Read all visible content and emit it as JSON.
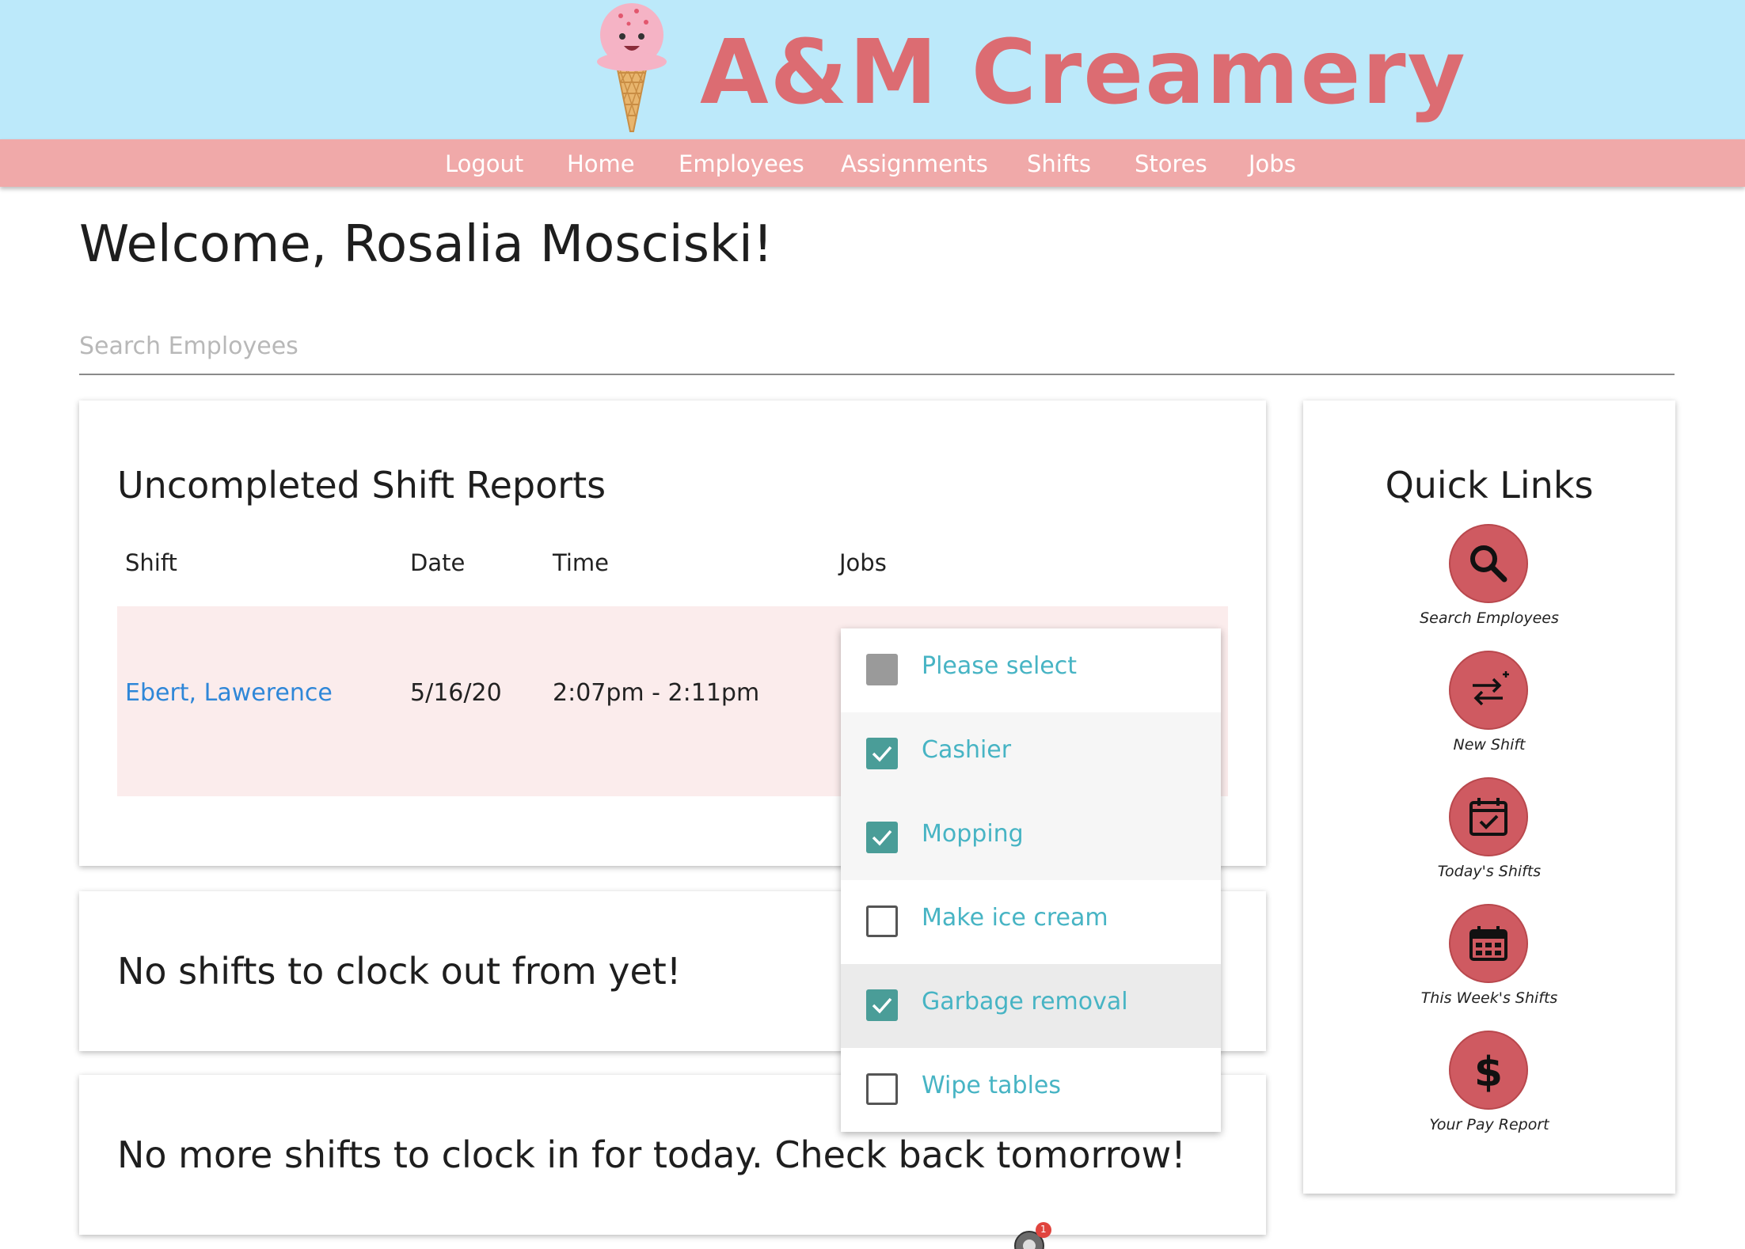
{
  "header": {
    "brand": "A&M Creamery",
    "logo": "ice-cream-cone-icon"
  },
  "nav": {
    "items": [
      {
        "label": "Logout"
      },
      {
        "label": "Home"
      },
      {
        "label": "Employees"
      },
      {
        "label": "Assignments"
      },
      {
        "label": "Shifts"
      },
      {
        "label": "Stores"
      },
      {
        "label": "Jobs"
      }
    ]
  },
  "welcome": "Welcome, Rosalia Mosciski!",
  "search": {
    "placeholder": "Search Employees",
    "value": ""
  },
  "shift_reports": {
    "title": "Uncompleted Shift Reports",
    "columns": [
      "Shift",
      "Date",
      "Time",
      "Jobs"
    ],
    "rows": [
      {
        "shift": "Ebert, Lawerence",
        "date": "5/16/20",
        "time": "2:07pm - 2:11pm"
      }
    ]
  },
  "jobs_dropdown": {
    "options": [
      {
        "label": "Please select",
        "state": "indeterminate"
      },
      {
        "label": "Cashier",
        "state": "checked"
      },
      {
        "label": "Mopping",
        "state": "checked"
      },
      {
        "label": "Make ice cream",
        "state": "unchecked"
      },
      {
        "label": "Garbage removal",
        "state": "checked"
      },
      {
        "label": "Wipe tables",
        "state": "unchecked"
      }
    ]
  },
  "clock_out_message": "No shifts to clock out from yet!",
  "clock_in_message": "No more shifts to clock in for today. Check back tomorrow!",
  "quick_links": {
    "title": "Quick Links",
    "items": [
      {
        "label": "Search Employees",
        "icon": "search-icon"
      },
      {
        "label": "New Shift",
        "icon": "swap-arrows-icon"
      },
      {
        "label": "Today's Shifts",
        "icon": "calendar-check-icon"
      },
      {
        "label": "This Week's Shifts",
        "icon": "calendar-week-icon"
      },
      {
        "label": "Your Pay Report",
        "icon": "dollar-icon"
      }
    ]
  },
  "dock_badge": "1",
  "colors": {
    "header_bg": "#bce9fa",
    "nav_bg": "#f0a9a9",
    "brand": "#dc6c72",
    "link": "#2f87d8",
    "option_text": "#47b4c4",
    "checkbox_checked": "#4a9d98",
    "quick_link_button": "#cf5a61"
  }
}
